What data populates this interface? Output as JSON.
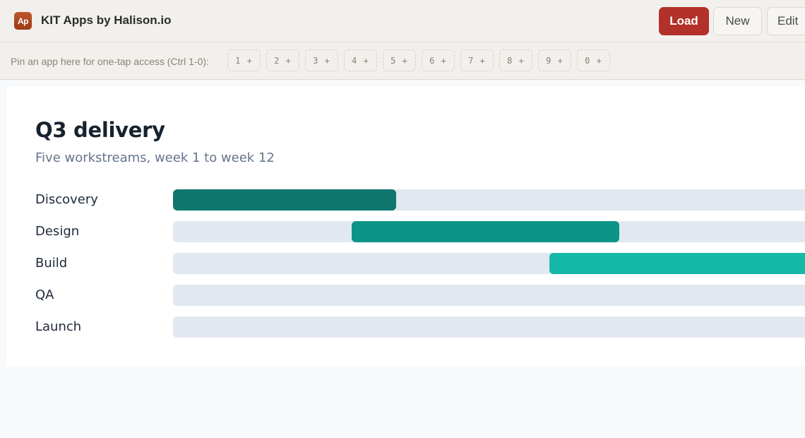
{
  "app": {
    "logo_text": "Ap",
    "title": "KIT Apps by Halison.io"
  },
  "toolbar": {
    "load_label": "Load",
    "new_label": "New",
    "edit_label": "Edit"
  },
  "pinbar": {
    "label": "Pin an app here for one-tap access (Ctrl 1-0):",
    "slots": [
      "1 +",
      "2 +",
      "3 +",
      "4 +",
      "5 +",
      "6 +",
      "7 +",
      "8 +",
      "9 +",
      "0 +"
    ]
  },
  "chart_data": {
    "type": "bar",
    "title": "Q3 delivery",
    "subtitle": "Five workstreams, week 1 to week 12",
    "x_range": [
      1,
      12
    ],
    "categories": [
      "Discovery",
      "Design",
      "Build",
      "QA",
      "Launch"
    ],
    "tasks": [
      {
        "name": "Discovery",
        "start": 1,
        "end": 4.5,
        "color": "#0f766e"
      },
      {
        "name": "Design",
        "start": 3.8,
        "end": 8,
        "color": "#0d9488"
      },
      {
        "name": "Build",
        "start": 6.9,
        "end": 12,
        "color": "#14b8a6"
      },
      {
        "name": "QA",
        "start": null,
        "end": null,
        "color": "#2dd4bf"
      },
      {
        "name": "Launch",
        "start": null,
        "end": null,
        "color": "#5eead4"
      }
    ],
    "track_color": "#e2e8f0"
  }
}
